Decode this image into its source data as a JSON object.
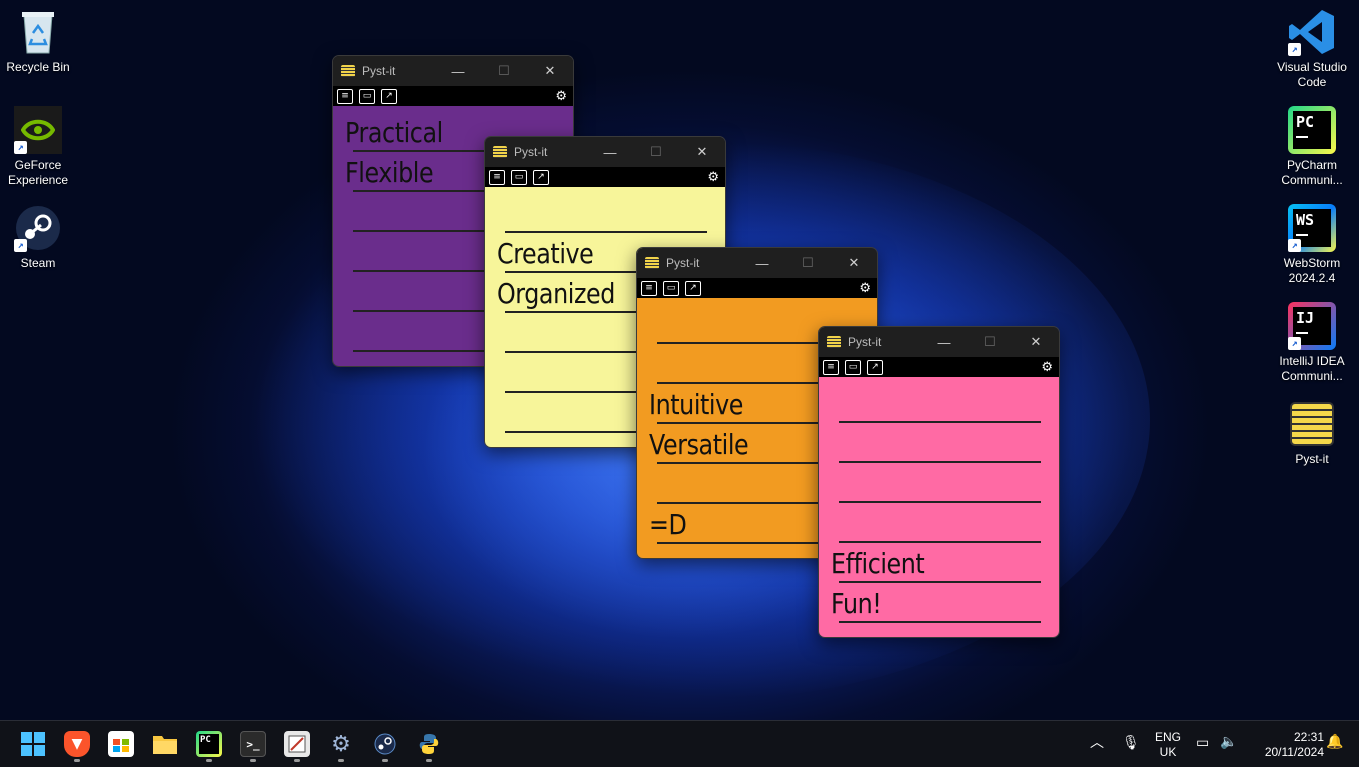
{
  "desktop_left": [
    {
      "label": "Recycle Bin",
      "icon": "recycle-bin-icon"
    },
    {
      "label": "GeForce Experience",
      "icon": "geforce-icon"
    },
    {
      "label": "Steam",
      "icon": "steam-icon"
    }
  ],
  "desktop_right": [
    {
      "label": "Visual Studio Code",
      "icon": "vscode-icon"
    },
    {
      "label": "PyCharm Communi...",
      "icon": "pycharm-icon"
    },
    {
      "label": "WebStorm 2024.2.4",
      "icon": "webstorm-icon"
    },
    {
      "label": "IntelliJ IDEA Communi...",
      "icon": "intellij-icon"
    },
    {
      "label": "Pyst-it",
      "icon": "pyst-it-icon"
    }
  ],
  "app_title": "Pyst-it",
  "notes": [
    {
      "color": "#6a2d8c",
      "lines": [
        "Practical",
        "Flexible"
      ]
    },
    {
      "color": "#f7f59a",
      "lines": [
        "Creative",
        "Organized"
      ]
    },
    {
      "color": "#f29b21",
      "lines": [
        "Intuitive",
        "Versatile",
        "=D"
      ]
    },
    {
      "color": "#ff6aa4",
      "lines": [
        "Efficient",
        "Fun!"
      ]
    }
  ],
  "tray": {
    "lang_top": "ENG",
    "lang_bottom": "UK",
    "time": "22:31",
    "date": "20/11/2024"
  },
  "colors": {
    "taskbar": "#101218",
    "titlebar": "#1f1f1f",
    "accent": "#1d4fe0"
  }
}
